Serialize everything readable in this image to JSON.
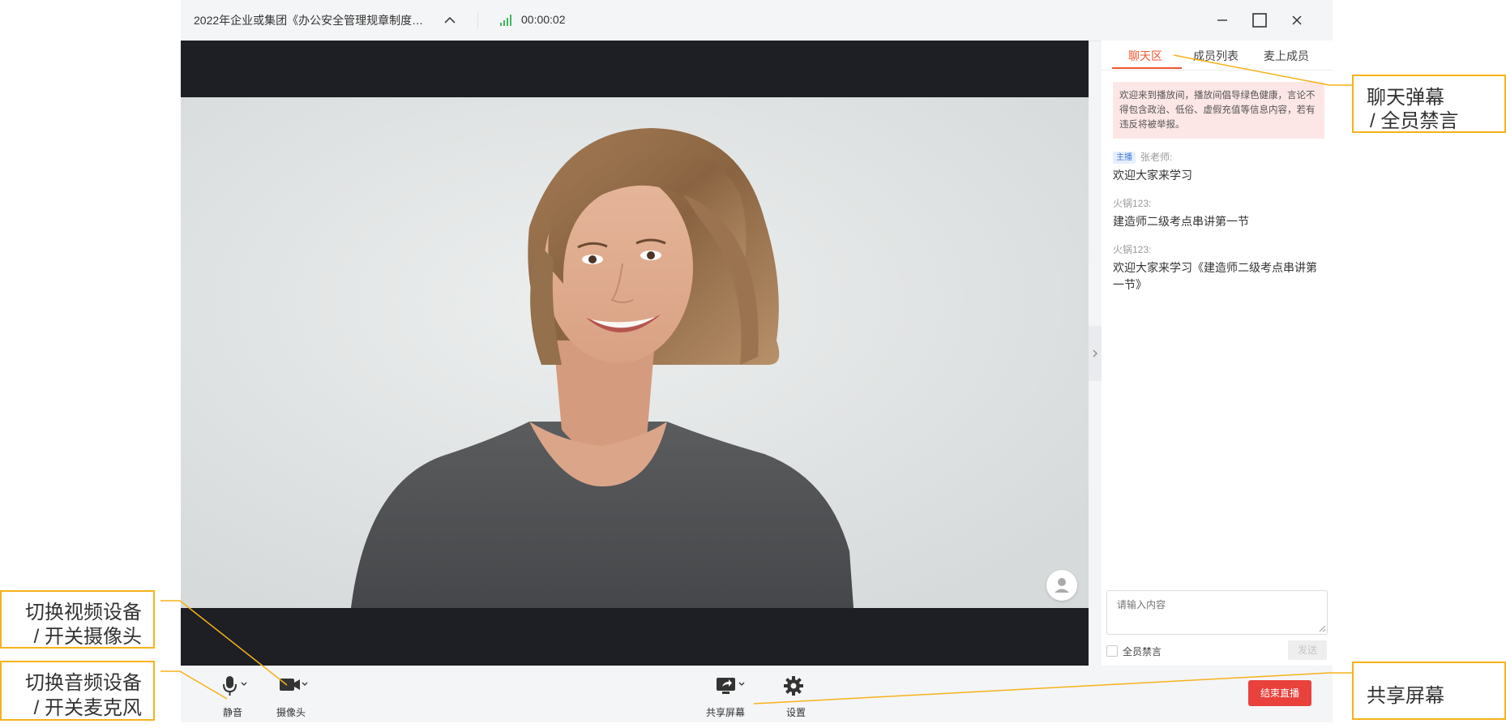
{
  "window": {
    "title": "2022年企业或集团《办公安全管理规章制度…",
    "timer": "00:00:02"
  },
  "sidebar": {
    "tabs": [
      {
        "label": "聊天区",
        "active": true
      },
      {
        "label": "成员列表",
        "active": false
      },
      {
        "label": "麦上成员",
        "active": false
      }
    ],
    "notice": "欢迎来到播放间，播放间倡导绿色健康，言论不得包含政治、低俗、虚假充值等信息内容，若有违反将被举报。",
    "messages": [
      {
        "badge": "主播",
        "name": "张老师:",
        "text": "欢迎大家来学习"
      },
      {
        "badge": "",
        "name": "火锅123:",
        "text": "建造师二级考点串讲第一节"
      },
      {
        "badge": "",
        "name": "火锅123:",
        "text": "欢迎大家来学习《建造师二级考点串讲第一节》"
      }
    ],
    "input_placeholder": "请输入内容",
    "mute_all_label": "全员禁言",
    "send_label": "发送"
  },
  "controls": {
    "mute_label": "静音",
    "camera_label": "摄像头",
    "share_label": "共享屏幕",
    "settings_label": "设置",
    "end_label": "结束直播"
  },
  "annotations": {
    "chat_danmu_line1": "聊天弹幕",
    "chat_danmu_line2": "/ 全员禁言",
    "video_line1": "切换视频设备",
    "video_line2": "/ 开关摄像头",
    "audio_line1": "切换音频设备",
    "audio_line2": "/ 开关麦克风",
    "share": "共享屏幕"
  },
  "colors": {
    "accent": "#f0572e",
    "end_button": "#e9413b",
    "annotation_border": "#f6b21a",
    "signal": "#3cb85c"
  }
}
